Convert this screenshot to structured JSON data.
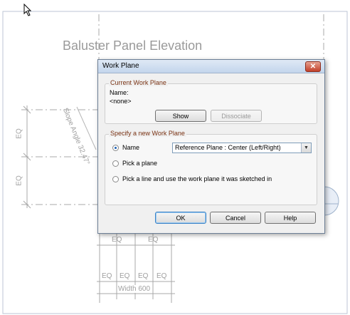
{
  "background": {
    "elevation_title": "Baluster Panel Elevation",
    "slope_label": "Slope Angle 32.47°",
    "side_dims": [
      "EQ",
      "EQ"
    ],
    "top_dims": [
      "EQ",
      "EQ"
    ],
    "bottom_dims": [
      "EQ",
      "EQ",
      "EQ",
      "EQ"
    ],
    "width_label": "Width 600",
    "colors": {
      "lines": "#a8a8a8",
      "frame": "#bcc6d4"
    }
  },
  "dialog": {
    "title": "Work Plane",
    "close_icon": "close-icon",
    "current": {
      "legend": "Current Work Plane",
      "name_label": "Name:",
      "name_value": "<none>",
      "show_label": "Show",
      "dissociate_label": "Dissociate"
    },
    "specify": {
      "legend": "Specify a new Work Plane",
      "options": [
        {
          "label": "Name",
          "checked": true
        },
        {
          "label": "Pick a plane",
          "checked": false
        },
        {
          "label": "Pick a line and use the work plane it was sketched in",
          "checked": false
        }
      ],
      "name_select_value": "Reference Plane : Center (Left/Right)"
    },
    "buttons": {
      "ok": "OK",
      "cancel": "Cancel",
      "help": "Help"
    },
    "colors": {
      "legend": "#7a3314",
      "accent": "#1a5fb4"
    }
  }
}
